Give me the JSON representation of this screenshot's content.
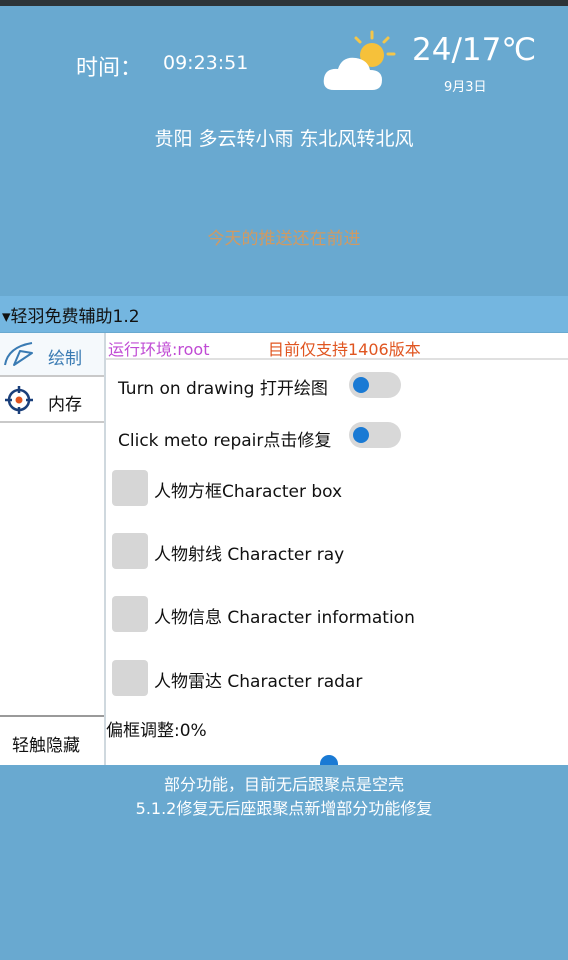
{
  "header": {
    "time_label": "时间：",
    "time_value": "09:23:51",
    "weather_icon": "partly-cloudy-sun-icon",
    "temperature": "24/17℃",
    "date": "9月3日",
    "city_line": "贵阳  多云转小雨  东北风转北风",
    "notice": "今天的推送还在前进"
  },
  "panel": {
    "title": "▾轻羽免费辅助1.2",
    "sidebar": {
      "items": [
        {
          "label": "绘制",
          "icon": "pen-curve-icon"
        },
        {
          "label": "内存",
          "icon": "crosshair-icon"
        }
      ],
      "hide_label": "轻触隐藏"
    },
    "env_label": "运行环境:root",
    "support_label": "目前仅支持1406版本",
    "switches": [
      {
        "label": "Turn on drawing 打开绘图",
        "on": false
      },
      {
        "label": "Click meto repair点击修复",
        "on": false
      }
    ],
    "checkboxes": [
      {
        "label": "人物方框Character box",
        "checked": false
      },
      {
        "label": "人物射线 Character ray",
        "checked": false
      },
      {
        "label": "人物信息 Character information",
        "checked": false
      },
      {
        "label": "人物雷达 Character radar",
        "checked": false
      }
    ],
    "offset_label": "偏框调整:0%",
    "offset_value_percent": 0
  },
  "bottom": {
    "line1": "部分功能，目前无后跟聚点是空壳",
    "line2": "5.1.2修复无后座跟聚点新增部分功能修复"
  },
  "colors": {
    "background": "#69a9d0",
    "title_bar": "#74b6e0",
    "accent": "#1a7ad4",
    "env_text": "#c04bd4",
    "support_text": "#e05520",
    "notice_text": "#e99749"
  }
}
